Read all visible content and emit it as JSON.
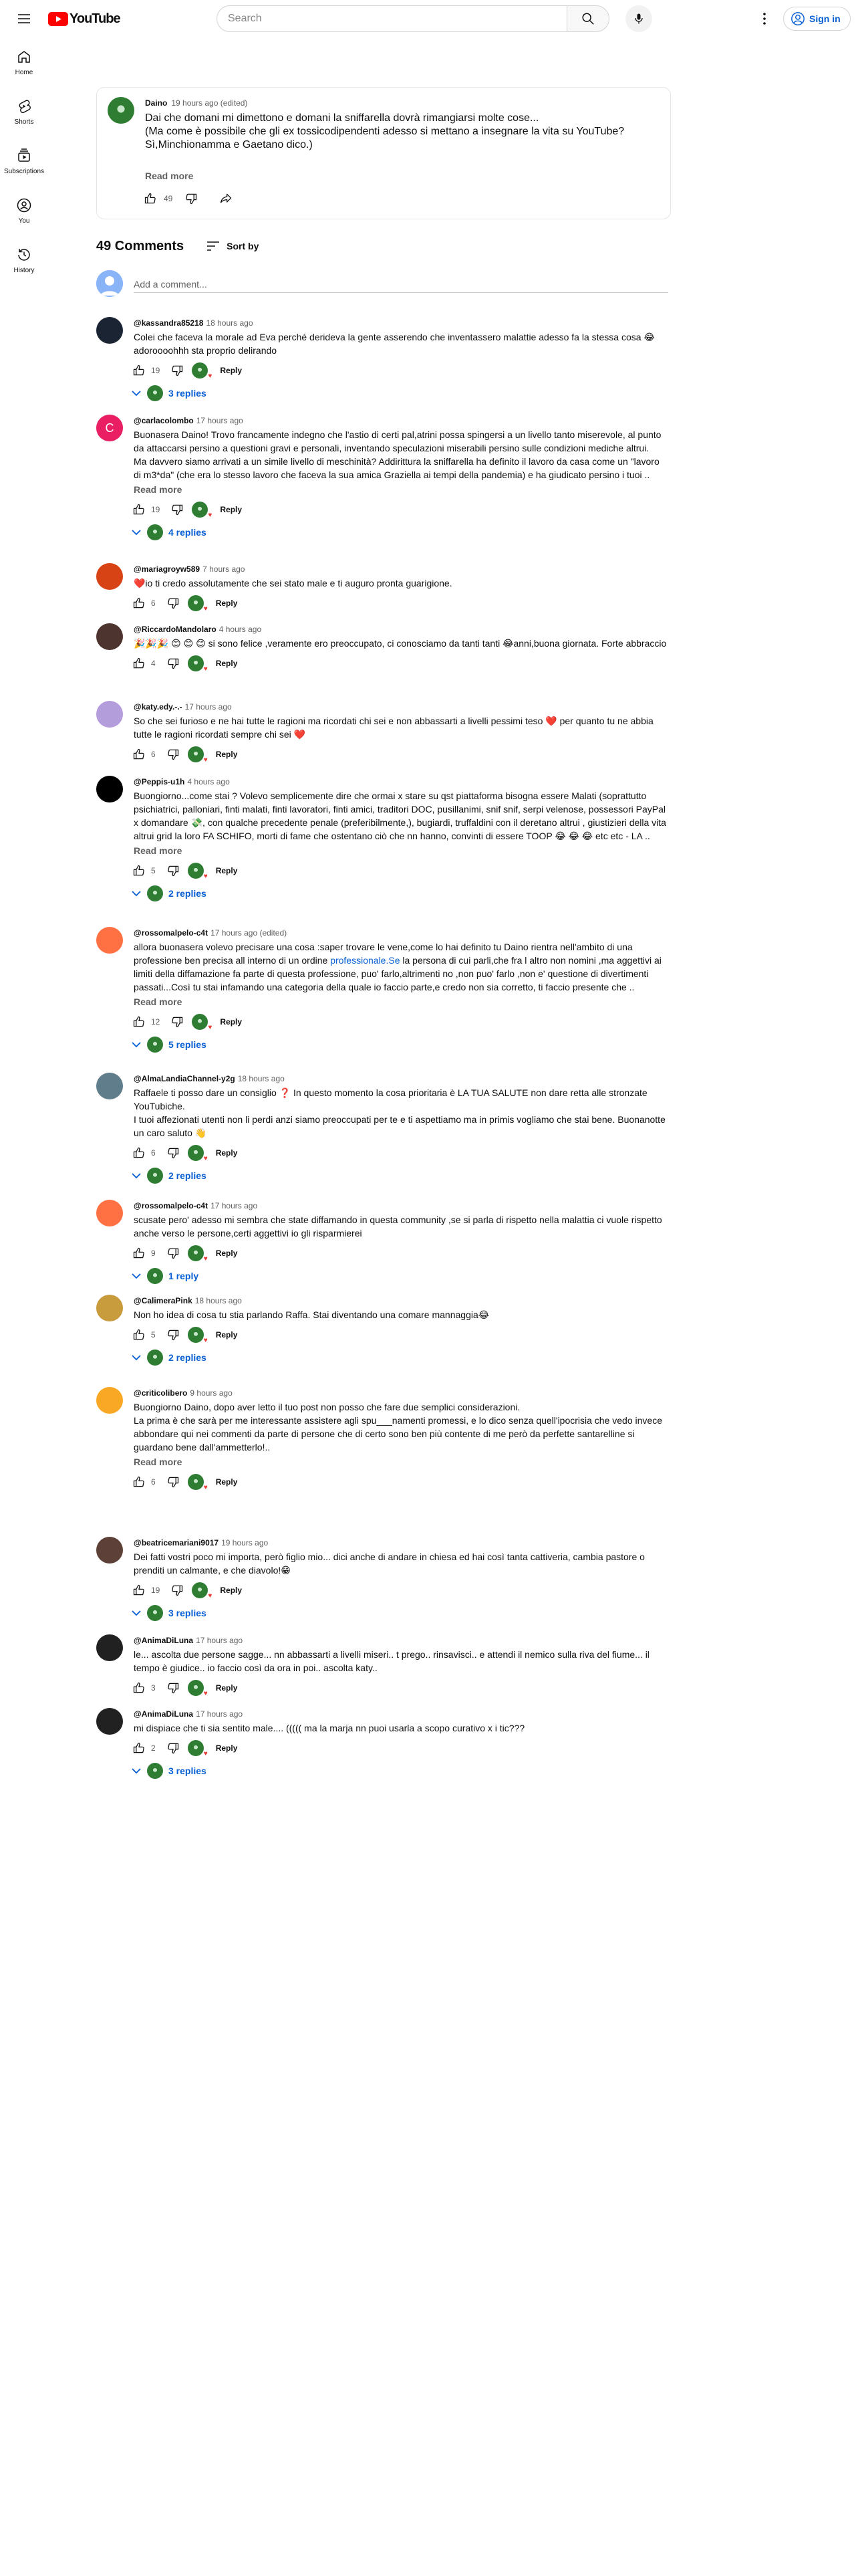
{
  "header": {
    "logo_text": "YouTube",
    "search_placeholder": "Search",
    "signin_label": "Sign in"
  },
  "nav": [
    {
      "label": "Home",
      "icon": "home-icon"
    },
    {
      "label": "Shorts",
      "icon": "shorts-icon"
    },
    {
      "label": "Subscriptions",
      "icon": "subscriptions-icon"
    },
    {
      "label": "You",
      "icon": "you-icon"
    },
    {
      "label": "History",
      "icon": "history-icon"
    }
  ],
  "post": {
    "author": "Daino",
    "time": "19 hours ago (edited)",
    "text": "Dai che domani mi dimettono e domani la sniffarella dovrà rimangiarsi molte cose...\n(Ma come è possibile che gli ex tossicodipendenti adesso si mettano a insegnare la vita su YouTube?\nSì,Minchionamma e Gaetano dico.)",
    "read_more": "Read more",
    "likes": "49"
  },
  "comments_header": {
    "count_label": "49 Comments",
    "sort_label": "Sort by",
    "add_placeholder": "Add a comment..."
  },
  "comments": [
    {
      "author": "@kassandra85218",
      "time": "18 hours ago",
      "text": "Colei che faceva la morale ad Eva perché derideva la gente asserendo che inventassero malattie adesso fa la stessa cosa 😂 adoroooohhh sta proprio delirando",
      "likes": "19",
      "replies": "3 replies",
      "avatar_color": "#1a2433",
      "avatar_letter": ""
    },
    {
      "author": "@carlacolombo",
      "time": "17 hours ago",
      "text": "Buonasera Daino! Trovo francamente indegno che l'astio di certi pal,atrini possa spingersi a un livello tanto miserevole, al punto da attaccarsi persino a questioni gravi e personali, inventando speculazioni miserabili persino sulle condizioni mediche altrui.\nMa davvero siamo arrivati a un simile livello di meschinità? Addirittura la sniffarella ha definito il lavoro da casa come un \"lavoro di m3*da\" (che era lo stesso lavoro che faceva la sua amica Graziella ai tempi della pandemia) e ha giudicato persino i tuoi ..",
      "read_more": "Read more",
      "likes": "19",
      "replies": "4 replies",
      "avatar_color": "#e91e63",
      "avatar_letter": "C"
    },
    {
      "author": "@mariagroyw589",
      "time": "7 hours ago",
      "text": "❤️io ti credo assolutamente che sei stato male e ti auguro pronta guarigione.",
      "likes": "6",
      "avatar_color": "#d84315",
      "avatar_letter": ""
    },
    {
      "author": "@RiccardoMandolaro",
      "time": "4 hours ago",
      "text": "🎉🎉🎉 😊 😊 😊 si sono felice ,veramente ero preoccupato, ci conosciamo da tanti tanti 😂anni,buona giornata. Forte abbraccio",
      "likes": "4",
      "avatar_color": "#4e342e",
      "avatar_letter": ""
    },
    {
      "author": "@katy.edy.-.-",
      "time": "17 hours ago",
      "text": "So che sei furioso e ne hai tutte le ragioni ma ricordati chi sei e non abbassarti a livelli pessimi teso ❤️ per quanto tu ne abbia tutte le ragioni ricordati sempre chi sei ❤️",
      "likes": "6",
      "avatar_color": "#b39ddb",
      "avatar_letter": ""
    },
    {
      "author": "@Peppis-u1h",
      "time": "4 hours ago",
      "text": "Buongiorno...come stai ? Volevo semplicemente dire che ormai x stare su qst piattaforma bisogna essere Malati (soprattutto psichiatrici, palloniari, finti malati, finti lavoratori, finti amici, traditori DOC, pusillanimi, snif snif, serpi velenose,  possessori PayPal x domandare 💸, con qualche precedente penale (preferibilmente,), bugiardi, truffaldini con il deretano altrui , giustizieri della vita altrui grid la loro FA SCHIFO, morti di fame che ostentano ciò che nn hanno, convinti di essere TOOP 😂 😂 😂  etc etc - LA ..",
      "read_more": "Read more",
      "likes": "5",
      "replies": "2 replies",
      "avatar_color": "#000000",
      "avatar_letter": ""
    },
    {
      "author": "@rossomalpelo-c4t",
      "time": "17 hours ago (edited)",
      "text_before": "allora buonasera volevo precisare una cosa :saper trovare le vene,come lo hai definito tu Daino rientra  nell'ambito di  una professione ben precisa all interno di un ordine ",
      "link_text": "professionale.Se",
      "text_after": " la persona di cui parli,che fra l altro non nomini ,ma aggettivi ai limiti della diffamazione fa parte di questa professione, puo' farlo,altrimenti no ,non puo' farlo ,non e' questione di divertimenti passati...Così tu stai infamando una categoria della quale io faccio parte,e credo non sia corretto, ti faccio presente che ..",
      "read_more": "Read more",
      "likes": "12",
      "replies": "5 replies",
      "avatar_color": "#ff7043",
      "avatar_letter": ""
    },
    {
      "author": "@AlmaLandiaChannel-y2g",
      "time": "18 hours ago",
      "text": "Raffaele ti posso dare un consiglio ❓ In questo momento la cosa prioritaria è LA TUA SALUTE non dare retta alle stronzate YouTubiche.\nI tuoi affezionati utenti non li perdi anzi siamo preoccupati per te e ti aspettiamo ma in primis vogliamo che stai bene. Buonanotte un caro saluto 👋",
      "likes": "6",
      "replies": "2 replies",
      "avatar_color": "#607d8b",
      "avatar_letter": ""
    },
    {
      "author": "@rossomalpelo-c4t",
      "time": "17 hours ago",
      "text": "scusate pero' adesso mi sembra che state diffamando in questa community ,se si parla di rispetto nella malattia ci vuole rispetto anche verso le persone,certi aggettivi io gli risparmierei",
      "likes": "9",
      "replies": "1 reply",
      "avatar_color": "#ff7043",
      "avatar_letter": ""
    },
    {
      "author": "@CalimeraPink",
      "time": "18 hours ago",
      "text": "Non ho idea di cosa tu stia parlando Raffa. Stai diventando una comare mannaggia😂",
      "likes": "5",
      "replies": "2 replies",
      "avatar_color": "#c89b3c",
      "avatar_letter": ""
    },
    {
      "author": "@criticolibero",
      "time": "9 hours ago",
      "text": "Buongiorno Daino, dopo aver letto il tuo post non posso che fare due semplici considerazioni.\nLa prima è che sarà per me interessante assistere agli spu___namenti promessi, e lo dico senza quell'ipocrisia che vedo invece abbondare qui nei commenti da parte di persone che di certo sono ben più contente di me però da perfette santarelline si guardano bene dall'ammetterlo!..",
      "read_more": "Read more",
      "likes": "6",
      "avatar_color": "#f9a825",
      "avatar_letter": ""
    },
    {
      "author": "@beatricemariani9017",
      "time": "19 hours ago",
      "text": "Dei fatti vostri poco mi importa, però figlio mio... dici anche di andare in chiesa ed hai così tanta cattiveria, cambia pastore o prenditi un calmante, e che diavolo!😁",
      "likes": "19",
      "replies": "3 replies",
      "avatar_color": "#5d4037",
      "avatar_letter": ""
    },
    {
      "author": "@AnimaDiLuna",
      "time": "17 hours ago",
      "text": "le... ascolta due persone sagge... nn abbassarti a livelli miseri.. t prego.. rinsavisci.. e attendi il nemico sulla riva del fiume... il tempo è giudice.. io faccio così da ora in poi.. ascolta katy..",
      "likes": "3",
      "avatar_color": "#212121",
      "avatar_letter": ""
    },
    {
      "author": "@AnimaDiLuna",
      "time": "17 hours ago",
      "text": "mi dispiace che ti sia sentito male.... ((((( ma la marja nn puoi usarla a scopo curativo x i tic???",
      "likes": "2",
      "replies": "3 replies",
      "avatar_color": "#212121",
      "avatar_letter": ""
    }
  ],
  "labels": {
    "reply": "Reply"
  },
  "colors": {
    "brand_red": "#ff0000",
    "link_blue": "#065fd4",
    "secondary_text": "#606060"
  }
}
